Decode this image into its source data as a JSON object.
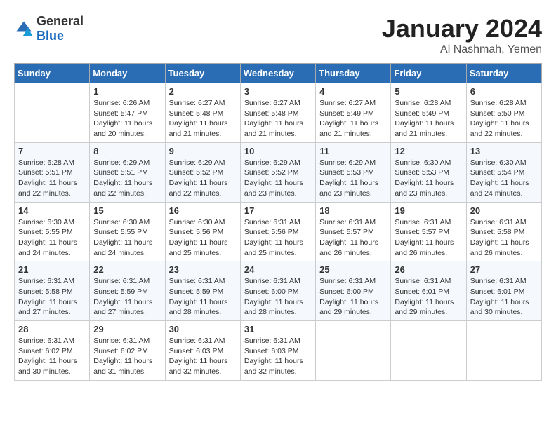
{
  "logo": {
    "general": "General",
    "blue": "Blue"
  },
  "title": {
    "month_year": "January 2024",
    "location": "Al Nashmah, Yemen"
  },
  "weekdays": [
    "Sunday",
    "Monday",
    "Tuesday",
    "Wednesday",
    "Thursday",
    "Friday",
    "Saturday"
  ],
  "weeks": [
    [
      {
        "day": "",
        "info": ""
      },
      {
        "day": "1",
        "info": "Sunrise: 6:26 AM\nSunset: 5:47 PM\nDaylight: 11 hours\nand 20 minutes."
      },
      {
        "day": "2",
        "info": "Sunrise: 6:27 AM\nSunset: 5:48 PM\nDaylight: 11 hours\nand 21 minutes."
      },
      {
        "day": "3",
        "info": "Sunrise: 6:27 AM\nSunset: 5:48 PM\nDaylight: 11 hours\nand 21 minutes."
      },
      {
        "day": "4",
        "info": "Sunrise: 6:27 AM\nSunset: 5:49 PM\nDaylight: 11 hours\nand 21 minutes."
      },
      {
        "day": "5",
        "info": "Sunrise: 6:28 AM\nSunset: 5:49 PM\nDaylight: 11 hours\nand 21 minutes."
      },
      {
        "day": "6",
        "info": "Sunrise: 6:28 AM\nSunset: 5:50 PM\nDaylight: 11 hours\nand 22 minutes."
      }
    ],
    [
      {
        "day": "7",
        "info": "Sunrise: 6:28 AM\nSunset: 5:51 PM\nDaylight: 11 hours\nand 22 minutes."
      },
      {
        "day": "8",
        "info": "Sunrise: 6:29 AM\nSunset: 5:51 PM\nDaylight: 11 hours\nand 22 minutes."
      },
      {
        "day": "9",
        "info": "Sunrise: 6:29 AM\nSunset: 5:52 PM\nDaylight: 11 hours\nand 22 minutes."
      },
      {
        "day": "10",
        "info": "Sunrise: 6:29 AM\nSunset: 5:52 PM\nDaylight: 11 hours\nand 23 minutes."
      },
      {
        "day": "11",
        "info": "Sunrise: 6:29 AM\nSunset: 5:53 PM\nDaylight: 11 hours\nand 23 minutes."
      },
      {
        "day": "12",
        "info": "Sunrise: 6:30 AM\nSunset: 5:53 PM\nDaylight: 11 hours\nand 23 minutes."
      },
      {
        "day": "13",
        "info": "Sunrise: 6:30 AM\nSunset: 5:54 PM\nDaylight: 11 hours\nand 24 minutes."
      }
    ],
    [
      {
        "day": "14",
        "info": "Sunrise: 6:30 AM\nSunset: 5:55 PM\nDaylight: 11 hours\nand 24 minutes."
      },
      {
        "day": "15",
        "info": "Sunrise: 6:30 AM\nSunset: 5:55 PM\nDaylight: 11 hours\nand 24 minutes."
      },
      {
        "day": "16",
        "info": "Sunrise: 6:30 AM\nSunset: 5:56 PM\nDaylight: 11 hours\nand 25 minutes."
      },
      {
        "day": "17",
        "info": "Sunrise: 6:31 AM\nSunset: 5:56 PM\nDaylight: 11 hours\nand 25 minutes."
      },
      {
        "day": "18",
        "info": "Sunrise: 6:31 AM\nSunset: 5:57 PM\nDaylight: 11 hours\nand 26 minutes."
      },
      {
        "day": "19",
        "info": "Sunrise: 6:31 AM\nSunset: 5:57 PM\nDaylight: 11 hours\nand 26 minutes."
      },
      {
        "day": "20",
        "info": "Sunrise: 6:31 AM\nSunset: 5:58 PM\nDaylight: 11 hours\nand 26 minutes."
      }
    ],
    [
      {
        "day": "21",
        "info": "Sunrise: 6:31 AM\nSunset: 5:58 PM\nDaylight: 11 hours\nand 27 minutes."
      },
      {
        "day": "22",
        "info": "Sunrise: 6:31 AM\nSunset: 5:59 PM\nDaylight: 11 hours\nand 27 minutes."
      },
      {
        "day": "23",
        "info": "Sunrise: 6:31 AM\nSunset: 5:59 PM\nDaylight: 11 hours\nand 28 minutes."
      },
      {
        "day": "24",
        "info": "Sunrise: 6:31 AM\nSunset: 6:00 PM\nDaylight: 11 hours\nand 28 minutes."
      },
      {
        "day": "25",
        "info": "Sunrise: 6:31 AM\nSunset: 6:00 PM\nDaylight: 11 hours\nand 29 minutes."
      },
      {
        "day": "26",
        "info": "Sunrise: 6:31 AM\nSunset: 6:01 PM\nDaylight: 11 hours\nand 29 minutes."
      },
      {
        "day": "27",
        "info": "Sunrise: 6:31 AM\nSunset: 6:01 PM\nDaylight: 11 hours\nand 30 minutes."
      }
    ],
    [
      {
        "day": "28",
        "info": "Sunrise: 6:31 AM\nSunset: 6:02 PM\nDaylight: 11 hours\nand 30 minutes."
      },
      {
        "day": "29",
        "info": "Sunrise: 6:31 AM\nSunset: 6:02 PM\nDaylight: 11 hours\nand 31 minutes."
      },
      {
        "day": "30",
        "info": "Sunrise: 6:31 AM\nSunset: 6:03 PM\nDaylight: 11 hours\nand 32 minutes."
      },
      {
        "day": "31",
        "info": "Sunrise: 6:31 AM\nSunset: 6:03 PM\nDaylight: 11 hours\nand 32 minutes."
      },
      {
        "day": "",
        "info": ""
      },
      {
        "day": "",
        "info": ""
      },
      {
        "day": "",
        "info": ""
      }
    ]
  ]
}
